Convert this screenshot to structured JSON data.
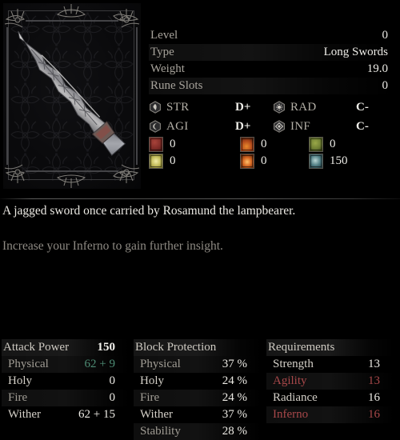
{
  "item": {
    "image_alt": "jagged-sword",
    "stats": [
      {
        "label": "Level",
        "value": "0",
        "striped": false
      },
      {
        "label": "Type",
        "value": "Long Swords",
        "striped": true
      },
      {
        "label": "Weight",
        "value": "19.0",
        "striped": false
      },
      {
        "label": "Rune Slots",
        "value": "0",
        "striped": true
      }
    ],
    "scaling": [
      {
        "icon": "strength-badge-icon",
        "name": "STR",
        "grade": "D+"
      },
      {
        "icon": "radiance-badge-icon",
        "name": "RAD",
        "grade": "C-"
      },
      {
        "icon": "agility-badge-icon",
        "name": "AGI",
        "grade": "D+"
      },
      {
        "icon": "inferno-badge-icon",
        "name": "INF",
        "grade": "C-"
      }
    ],
    "damage": [
      {
        "icon": "physical-damage-icon",
        "color": "#7e2b26",
        "value": "0"
      },
      {
        "icon": "fire-damage-icon",
        "color": "#b0471a",
        "value": "0"
      },
      {
        "icon": "wither-damage-icon",
        "color": "#6d7d32",
        "value": "0"
      },
      {
        "icon": "holy-damage-icon",
        "color": "#c3bc5a",
        "value": "0"
      },
      {
        "icon": "inferno-damage-icon",
        "color": "#d2631f",
        "value": "0"
      },
      {
        "icon": "frost-damage-icon",
        "color": "#4e7c82",
        "value": "150"
      }
    ],
    "description": "A jagged sword once carried by Rosamund the lampbearer.",
    "hint": "Increase your Inferno to gain further insight."
  },
  "attack_power": {
    "title": "Attack Power",
    "total": "150",
    "rows": [
      {
        "label": "Physical",
        "value": "62 + 9",
        "value_color": "green",
        "striped": true
      },
      {
        "label": "Holy",
        "value": "0",
        "value_color": "",
        "striped": false
      },
      {
        "label": "Fire",
        "value": "0",
        "value_color": "",
        "striped": true
      },
      {
        "label": "Wither",
        "value": "62 + 15",
        "value_color": "",
        "striped": false
      }
    ]
  },
  "block_protection": {
    "title": "Block Protection",
    "rows": [
      {
        "label": "Physical",
        "value": "37 %",
        "striped": true
      },
      {
        "label": "Holy",
        "value": "24 %",
        "striped": false
      },
      {
        "label": "Fire",
        "value": "24 %",
        "striped": true
      },
      {
        "label": "Wither",
        "value": "37 %",
        "striped": false
      },
      {
        "label": "Stability",
        "value": "28 %",
        "striped": true
      }
    ]
  },
  "requirements": {
    "title": "Requirements",
    "rows": [
      {
        "label": "Strength",
        "value": "13",
        "unmet": false,
        "striped": false
      },
      {
        "label": "Agility",
        "value": "13",
        "unmet": true,
        "striped": true
      },
      {
        "label": "Radiance",
        "value": "16",
        "unmet": false,
        "striped": false
      },
      {
        "label": "Inferno",
        "value": "16",
        "unmet": true,
        "striped": true
      }
    ]
  },
  "colors": {
    "scaling_good": "#4d8c74",
    "requirement_unmet": "#a8484a",
    "text_primary": "#ecebe6",
    "text_muted": "#a09c94"
  }
}
